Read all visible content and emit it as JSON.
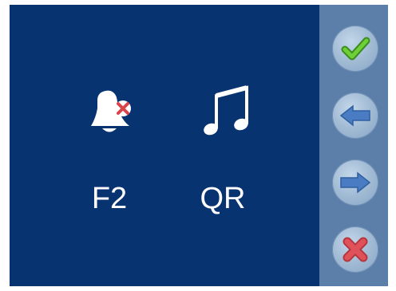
{
  "options": [
    {
      "label": "F2",
      "icon": "bell-muted-icon"
    },
    {
      "label": "QR",
      "icon": "music-note-icon"
    }
  ],
  "side_buttons": [
    {
      "icon": "checkmark-icon"
    },
    {
      "icon": "arrow-left-icon"
    },
    {
      "icon": "arrow-right-icon"
    },
    {
      "icon": "close-icon"
    }
  ],
  "colors": {
    "main_background": "#083371",
    "side_panel": "#5c7fa9",
    "check": "#5bbb2f",
    "arrow": "#3f6fb8",
    "close": "#d9454b"
  }
}
